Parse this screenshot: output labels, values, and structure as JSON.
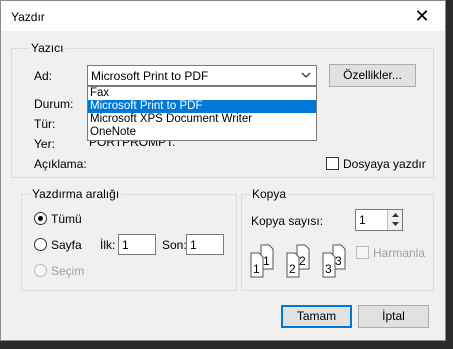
{
  "dialog": {
    "title": "Yazdır",
    "close_glyph": "✕"
  },
  "printer_group": {
    "label": "Yazıcı",
    "name_label": "Ad:",
    "selected_printer": "Microsoft Print to PDF",
    "properties_button": "Özellikler...",
    "status_label": "Durum:",
    "type_label": "Tür:",
    "where_label": "Yer:",
    "where_value": "PORTPROMPT:",
    "comment_label": "Açıklama:",
    "print_to_file_label": "Dosyaya yazdır",
    "print_to_file_checked": false,
    "dropdown_options": [
      {
        "label": "Fax",
        "selected": false
      },
      {
        "label": "Microsoft Print to PDF",
        "selected": true
      },
      {
        "label": "Microsoft XPS Document Writer",
        "selected": false
      },
      {
        "label": "OneNote",
        "selected": false
      }
    ]
  },
  "range_group": {
    "label": "Yazdırma aralığı",
    "all_label": "Tümü",
    "all_checked": true,
    "pages_label": "Sayfa",
    "from_label": "İlk:",
    "from_value": "1",
    "to_label": "Son:",
    "to_value": "1",
    "selection_label": "Seçim",
    "selection_enabled": false
  },
  "copies_group": {
    "label": "Kopya",
    "count_label": "Kopya sayısı:",
    "count_value": "1",
    "collate_label": "Harmanla",
    "collate_enabled": false,
    "collate_pages": [
      "1",
      "1",
      "2",
      "2",
      "3",
      "3"
    ]
  },
  "buttons": {
    "ok": "Tamam",
    "cancel": "İptal"
  },
  "colors": {
    "accent": "#0078d7",
    "dialog_bg": "#f0f0f0",
    "backdrop": "#2b2b2b"
  }
}
